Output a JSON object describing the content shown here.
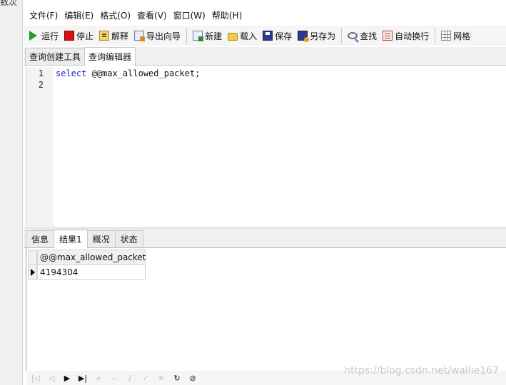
{
  "left_panel": {
    "text": "数次"
  },
  "menu": {
    "items": [
      {
        "id": "file",
        "label": "文件(F)"
      },
      {
        "id": "edit",
        "label": "编辑(E)"
      },
      {
        "id": "format",
        "label": "格式(O)"
      },
      {
        "id": "view",
        "label": "查看(V)"
      },
      {
        "id": "window",
        "label": "窗口(W)"
      },
      {
        "id": "help",
        "label": "帮助(H)"
      }
    ]
  },
  "toolbar": {
    "run": "运行",
    "stop": "停止",
    "explain": "解释",
    "export_wizard": "导出向导",
    "new": "新建",
    "load": "载入",
    "save": "保存",
    "save_as": "另存为",
    "find": "查找",
    "word_wrap": "自动换行",
    "grid": "网格"
  },
  "top_tabs": [
    {
      "label": "查询创建工具",
      "active": false
    },
    {
      "label": "查询编辑器",
      "active": true
    }
  ],
  "editor": {
    "line_numbers": [
      "1",
      "2"
    ],
    "keyword": "select",
    "rest": " @@max_allowed_packet;"
  },
  "result_tabs": [
    {
      "label": "信息",
      "active": false
    },
    {
      "label": "结果1",
      "active": true
    },
    {
      "label": "概况",
      "active": false
    },
    {
      "label": "状态",
      "active": false
    }
  ],
  "result_grid": {
    "columns": [
      "@@max_allowed_packet"
    ],
    "rows": [
      [
        "4194304"
      ]
    ]
  },
  "navigator": {
    "buttons": [
      {
        "name": "first-record",
        "glyph": "|◁",
        "enabled": false
      },
      {
        "name": "prev-record",
        "glyph": "◁",
        "enabled": false
      },
      {
        "name": "next-record",
        "glyph": "▶",
        "enabled": true
      },
      {
        "name": "last-record",
        "glyph": "▶|",
        "enabled": true
      },
      {
        "name": "add-record",
        "glyph": "+",
        "enabled": false
      },
      {
        "name": "delete-record",
        "glyph": "—",
        "enabled": false
      },
      {
        "name": "edit-record",
        "glyph": "∕",
        "enabled": false
      },
      {
        "name": "apply-changes",
        "glyph": "✓",
        "enabled": false
      },
      {
        "name": "discard-changes",
        "glyph": "✕",
        "enabled": false
      },
      {
        "name": "refresh",
        "glyph": "↻",
        "enabled": true
      },
      {
        "name": "stop-query",
        "glyph": "⊘",
        "enabled": true
      }
    ]
  },
  "watermark": "https://blog.csdn.net/wallie167"
}
